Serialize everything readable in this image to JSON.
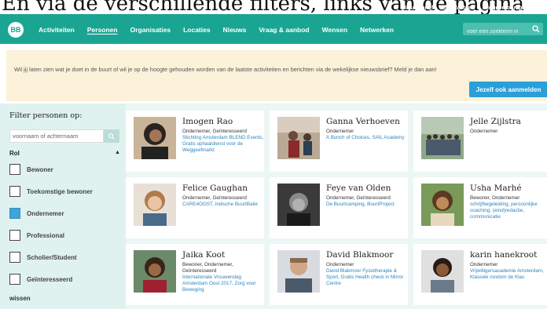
{
  "caption": "En via de verschillende filters, links van de pagina",
  "utility_links": [
    "Nieuwsbrief",
    "Iets plaatsen",
    "Inloggen of registreren"
  ],
  "logo_text": "BB",
  "nav": {
    "items": [
      "Activiteiten",
      "Personen",
      "Organisaties",
      "Locaties",
      "Nieuws",
      "Vraag & aanbod",
      "Wensen",
      "Netwerken"
    ],
    "active": "Personen",
    "search_placeholder": "voer een zoekterm in"
  },
  "banner": {
    "text": "Wil jij laten zien wat je doet in de buurt of wil je op de hoogte gehouden worden van de laatste activiteiten en berichten via de wekelijkse nieuwsbrief? Meld je dan aan!",
    "button_label": "Jezelf ook aanmelden"
  },
  "sidebar": {
    "title": "Filter personen op:",
    "input_placeholder": "voornaam of achternaam",
    "rol_label": "Rol",
    "roles": [
      {
        "label": "Bewoner",
        "checked": false
      },
      {
        "label": "Toekomstige bewoner",
        "checked": false
      },
      {
        "label": "Ondernemer",
        "checked": true
      },
      {
        "label": "Professional",
        "checked": false
      },
      {
        "label": "Scholier/Student",
        "checked": false
      },
      {
        "label": "Geïnteresseerd",
        "checked": false
      }
    ],
    "reset_label": "wissen"
  },
  "people": [
    {
      "name": "Imogen Rao",
      "role": "Ondernemer, Geïnteresseerd",
      "tags": "Stichting Amsterdam BLEND Events, Gratis ophaaldienst voor de Weggeefmarkt"
    },
    {
      "name": "Ganna Verhoeven",
      "role": "Ondernemer",
      "tags": "A Bunch of Choices, SAIL Academy"
    },
    {
      "name": "Jelle Zijlstra",
      "role": "Ondernemer",
      "tags": ""
    },
    {
      "name": "Felice Gaughan",
      "role": "Ondernemer, Geïnteresseerd",
      "tags": "CARE4OOST, Indische BuurtBalie"
    },
    {
      "name": "Feye van Olden",
      "role": "Ondernemer, Geïnteresseerd",
      "tags": "De Buurtcamping, BuurtProject"
    },
    {
      "name": "Usha Marhé",
      "role": "Bewoner, Ondernemer",
      "tags": "schrijfbegeleiding, persoonlijke coaching, (eind)redactie, communicatie"
    },
    {
      "name": "Jaika Koot",
      "role": "Bewoner, Ondernemer, Geïnteresseerd",
      "tags": "Internationale Vrouwendag Amsterdam Oost 2017, Zorg voor Beweging"
    },
    {
      "name": "David Blakmoor",
      "role": "Ondernemer",
      "tags": "David Blakmoor Fysiotherapie & Sport, Gratis Health check in Mirror Centre"
    },
    {
      "name": "karin hanekroot",
      "role": "Ondernemer",
      "tags": "Vrijwilligersacademie Amsterdam, Klassiek rondom de Klas"
    }
  ]
}
